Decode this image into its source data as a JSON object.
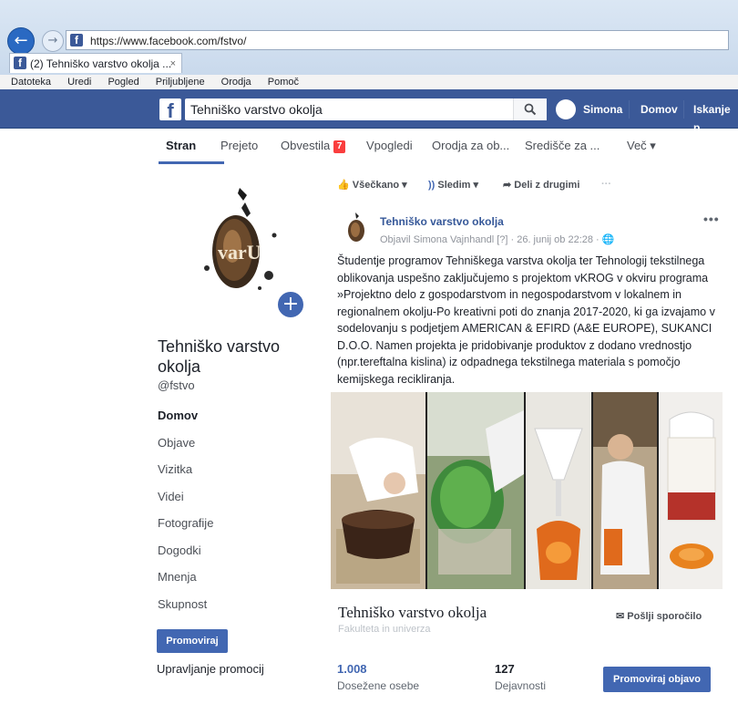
{
  "browser": {
    "url": "https://www.facebook.com/fstvo/",
    "tab_title": "(2) Tehniško varstvo okolja ...",
    "tab_close": "×",
    "menu": [
      "Datoteka",
      "Uredi",
      "Pogled",
      "Priljubljene",
      "Orodja",
      "Pomoč"
    ]
  },
  "fb_header": {
    "logo": "f",
    "search_value": "Tehniško varstvo okolja",
    "search_icon": "search-icon",
    "user_name": "Simona",
    "home": "Domov",
    "find": "Iskanje p"
  },
  "page_tabs": {
    "items": [
      "Stran",
      "Prejeto",
      "Obvestila",
      "Vpogledi",
      "Orodja za ob...",
      "Središče za ...",
      "Več ▾"
    ],
    "notification_count": "7"
  },
  "sidebar": {
    "page_name": "Tehniško varstvo okolja",
    "handle": "@fstvo",
    "nav": [
      "Domov",
      "Objave",
      "Vizitka",
      "Videi",
      "Fotografije",
      "Dogodki",
      "Mnenja",
      "Skupnost"
    ],
    "promote": "Promoviraj",
    "manage_promotions": "Upravljanje promocij"
  },
  "actions": {
    "liked": "Všečkano ▾",
    "following": "Sledim ▾",
    "share": "Deli z drugimi",
    "more": "···"
  },
  "post": {
    "author": "Tehniško varstvo okolja",
    "meta": "Objavil Simona Vajnhandl [?] · 26. junij ob 22:28 · 🌐",
    "more": "•••",
    "text": "Študentje programov Tehniškega varstva okolja ter Tehnologij tekstilnega oblikovanja uspešno zaključujemo s projektom vKROG v okviru programa »Projektno delo z gospodarstvom in negospodarstvom v lokalnem in regionalnem okolju-Po kreativni poti do znanja 2017-2020, ki ga izvajamo v sodelovanju s podjetjem AMERICAN & EFIRD (A&E EUROPE), SUKANCI D.O.O. Namen projekta je pridobivanje produktov z dodano vrednostjo (npr.tereftalna kislina) iz odpadnega tekstilnega materiala s pomočjo kemijskega recikliranja."
  },
  "card": {
    "title": "Tehniško varstvo okolja",
    "subtitle": "Fakulteta in univerza",
    "send_message": "Pošlji sporočilo",
    "reach_value": "1.008",
    "reach_label": "Dosežene osebe",
    "engagement_value": "127",
    "engagement_label": "Dejavnosti",
    "promote_post": "Promoviraj objavo"
  },
  "colors": {
    "fb_blue": "#3b5998",
    "button_blue": "#4267b2",
    "link_blue": "#365899",
    "badge_red": "#fa3e3e"
  }
}
